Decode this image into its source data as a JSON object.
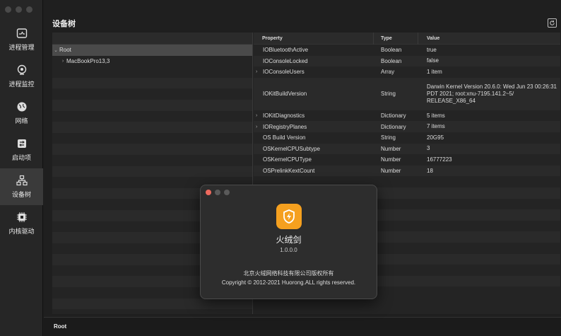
{
  "sidebar": {
    "items": [
      {
        "label": "进程管理",
        "icon": "process-manage-icon"
      },
      {
        "label": "进程监控",
        "icon": "process-monitor-icon"
      },
      {
        "label": "网络",
        "icon": "network-icon"
      },
      {
        "label": "启动项",
        "icon": "startup-icon"
      },
      {
        "label": "设备树",
        "icon": "device-tree-icon",
        "active": true
      },
      {
        "label": "内核驱动",
        "icon": "kernel-driver-icon"
      }
    ]
  },
  "header": {
    "title": "设备树"
  },
  "tree": {
    "root_label": "Root",
    "child_label": "MacBookPro13,3"
  },
  "table": {
    "columns": [
      "Property",
      "Type",
      "Value"
    ],
    "rows": [
      {
        "property": "IOBluetoothActive",
        "type": "Boolean",
        "value": "true",
        "expandable": false
      },
      {
        "property": "IOConsoleLocked",
        "type": "Boolean",
        "value": "false",
        "expandable": false
      },
      {
        "property": "IOConsoleUsers",
        "type": "Array",
        "value": "1 item",
        "expandable": true
      },
      {
        "property": "IOKitBuildVersion",
        "type": "String",
        "value": "Darwin Kernel Version 20.6.0: Wed Jun 23 00:26:31 PDT 2021; root:xnu-7195.141.2~5/ RELEASE_X86_64",
        "expandable": false
      },
      {
        "property": "IOKitDiagnostics",
        "type": "Dictionary",
        "value": "5 items",
        "expandable": true
      },
      {
        "property": "IORegistryPlanes",
        "type": "Dictionary",
        "value": "7 items",
        "expandable": true
      },
      {
        "property": "OS Build Version",
        "type": "String",
        "value": "20G95",
        "expandable": false
      },
      {
        "property": "OSKernelCPUSubtype",
        "type": "Number",
        "value": "3",
        "expandable": false
      },
      {
        "property": "OSKernelCPUType",
        "type": "Number",
        "value": "16777223",
        "expandable": false
      },
      {
        "property": "OSPrelinkKextCount",
        "type": "Number",
        "value": "18",
        "expandable": false
      }
    ]
  },
  "status": {
    "text": "Root"
  },
  "about": {
    "app_name": "火绒剑",
    "version": "1.0.0.0",
    "company": "北京火绒网络科技有限公司版权所有",
    "copyright": "Copyright © 2012-2021 Huorong.ALL rights reserved.",
    "icon": "huorong-shield-icon",
    "icon_color": "#f5a01f"
  },
  "colors": {
    "traffic_close": "#ee6a5e",
    "traffic_min": "#5a5a5a",
    "traffic_max": "#5a5a5a"
  }
}
